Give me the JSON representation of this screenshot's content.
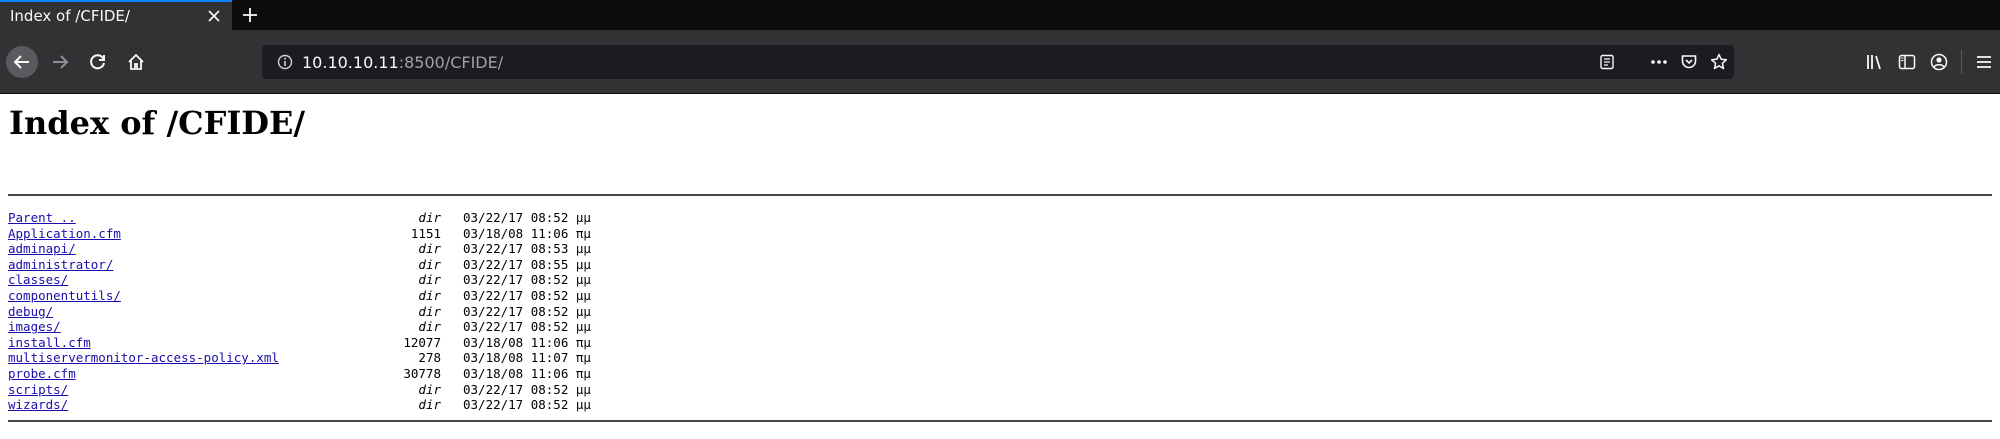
{
  "browser": {
    "tab_title": "Index of /CFIDE/",
    "url_host": "10.10.10.11",
    "url_rest": ":8500/CFIDE/"
  },
  "page": {
    "title": "Index of /CFIDE/",
    "entries": [
      {
        "name": "Parent ..",
        "size": "dir",
        "date": "03/22/17 08:52 μμ"
      },
      {
        "name": "Application.cfm",
        "size": "1151",
        "date": "03/18/08 11:06 πμ"
      },
      {
        "name": "adminapi/",
        "size": "dir",
        "date": "03/22/17 08:53 μμ"
      },
      {
        "name": "administrator/",
        "size": "dir",
        "date": "03/22/17 08:55 μμ"
      },
      {
        "name": "classes/",
        "size": "dir",
        "date": "03/22/17 08:52 μμ"
      },
      {
        "name": "componentutils/",
        "size": "dir",
        "date": "03/22/17 08:52 μμ"
      },
      {
        "name": "debug/",
        "size": "dir",
        "date": "03/22/17 08:52 μμ"
      },
      {
        "name": "images/",
        "size": "dir",
        "date": "03/22/17 08:52 μμ"
      },
      {
        "name": "install.cfm",
        "size": "12077",
        "date": "03/18/08 11:06 πμ"
      },
      {
        "name": "multiservermonitor-access-policy.xml",
        "size": "278",
        "date": "03/18/08 11:07 πμ"
      },
      {
        "name": "probe.cfm",
        "size": "30778",
        "date": "03/18/08 11:06 πμ"
      },
      {
        "name": "scripts/",
        "size": "dir",
        "date": "03/22/17 08:52 μμ"
      },
      {
        "name": "wizards/",
        "size": "dir",
        "date": "03/22/17 08:52 μμ"
      }
    ]
  },
  "icons": {
    "tab_close": "close-icon",
    "new_tab": "plus-icon",
    "back": "arrow-left-icon",
    "forward": "arrow-right-icon",
    "reload": "reload-icon",
    "home": "home-icon",
    "site_info": "info-icon",
    "reader": "reader-view-icon",
    "page_actions": "more-icon",
    "pocket": "pocket-icon",
    "bookmark": "star-icon",
    "library": "library-icon",
    "sidebar": "sidebar-icon",
    "account": "account-icon",
    "menu": "hamburger-menu-icon"
  }
}
